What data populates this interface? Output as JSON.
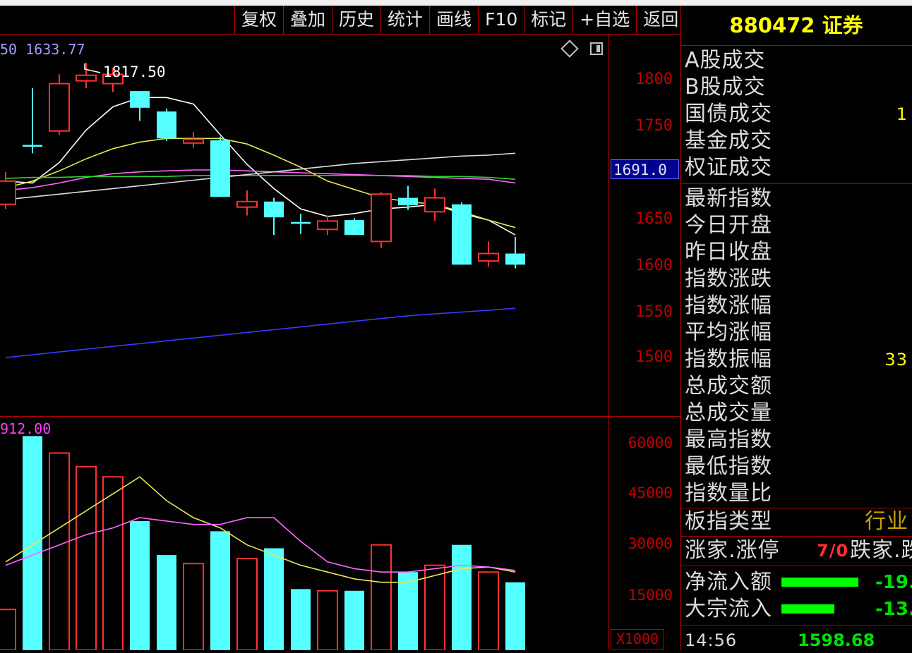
{
  "toolbar": {
    "buttons": [
      "复权",
      "叠加",
      "历史",
      "统计",
      "画线",
      "F10",
      "标记",
      "+自选",
      "返回"
    ]
  },
  "legend": {
    "top_text": "50  1633.77",
    "vol_text": "912.00"
  },
  "chart": {
    "high_label": "1817.50",
    "current_price_tag": "1691.0",
    "vol_unit": "X1000",
    "price_ticks": [
      "1800",
      "1750",
      "1650",
      "1600",
      "1550",
      "1500"
    ],
    "vol_ticks": [
      "60000",
      "45000",
      "30000",
      "15000"
    ]
  },
  "chart_data": {
    "type": "candlestick",
    "price_axis": {
      "ticks": [
        1800,
        1750,
        1650,
        1600,
        1550,
        1500
      ],
      "range": [
        1445,
        1880
      ]
    },
    "volume_axis": {
      "ticks": [
        60000,
        45000,
        30000,
        15000
      ],
      "unit": "X1000",
      "range": [
        0,
        62000
      ]
    },
    "candles": [
      {
        "o": 1665,
        "c": 1690,
        "h": 1700,
        "l": 1660,
        "color": "red"
      },
      {
        "o": 1727,
        "c": 1729,
        "h": 1790,
        "l": 1720,
        "color": "cyan"
      },
      {
        "o": 1744,
        "c": 1795,
        "h": 1805,
        "l": 1740,
        "color": "red"
      },
      {
        "o": 1798,
        "c": 1804,
        "h": 1817.5,
        "l": 1790,
        "color": "red"
      },
      {
        "o": 1795,
        "c": 1805,
        "h": 1812,
        "l": 1786,
        "color": "red"
      },
      {
        "o": 1787,
        "c": 1769,
        "h": 1787,
        "l": 1755,
        "color": "cyan"
      },
      {
        "o": 1765,
        "c": 1736,
        "h": 1768,
        "l": 1733,
        "color": "cyan"
      },
      {
        "o": 1731,
        "c": 1735,
        "h": 1743,
        "l": 1726,
        "color": "red"
      },
      {
        "o": 1734,
        "c": 1673,
        "h": 1738,
        "l": 1673,
        "color": "cyan"
      },
      {
        "o": 1662,
        "c": 1668,
        "h": 1680,
        "l": 1653,
        "color": "red"
      },
      {
        "o": 1668,
        "c": 1651,
        "h": 1672,
        "l": 1632,
        "color": "cyan"
      },
      {
        "o": 1646,
        "c": 1644,
        "h": 1655,
        "l": 1633,
        "color": "cyan"
      },
      {
        "o": 1638,
        "c": 1647,
        "h": 1653,
        "l": 1632,
        "color": "red"
      },
      {
        "o": 1648,
        "c": 1632,
        "h": 1650,
        "l": 1632,
        "color": "cyan"
      },
      {
        "o": 1625,
        "c": 1676,
        "h": 1678,
        "l": 1618,
        "color": "red"
      },
      {
        "o": 1672,
        "c": 1664,
        "h": 1685,
        "l": 1659,
        "color": "cyan"
      },
      {
        "o": 1657,
        "c": 1672,
        "h": 1682,
        "l": 1647,
        "color": "red"
      },
      {
        "o": 1665,
        "c": 1600,
        "h": 1667,
        "l": 1600,
        "color": "cyan"
      },
      {
        "o": 1604,
        "c": 1612,
        "h": 1625,
        "l": 1598,
        "color": "red"
      },
      {
        "o": 1612,
        "c": 1600,
        "h": 1630,
        "l": 1596,
        "color": "cyan"
      }
    ],
    "volumes": [
      {
        "v": 11000,
        "color": "red"
      },
      {
        "v": 62000,
        "color": "cyan"
      },
      {
        "v": 57000,
        "color": "red"
      },
      {
        "v": 53000,
        "color": "red"
      },
      {
        "v": 50000,
        "color": "red"
      },
      {
        "v": 37000,
        "color": "cyan"
      },
      {
        "v": 27000,
        "color": "cyan"
      },
      {
        "v": 24500,
        "color": "red"
      },
      {
        "v": 34000,
        "color": "cyan"
      },
      {
        "v": 26000,
        "color": "red"
      },
      {
        "v": 29000,
        "color": "cyan"
      },
      {
        "v": 17000,
        "color": "cyan"
      },
      {
        "v": 16500,
        "color": "red"
      },
      {
        "v": 16500,
        "color": "cyan"
      },
      {
        "v": 30000,
        "color": "red"
      },
      {
        "v": 22000,
        "color": "cyan"
      },
      {
        "v": 24000,
        "color": "red"
      },
      {
        "v": 30000,
        "color": "cyan"
      },
      {
        "v": 22000,
        "color": "red"
      },
      {
        "v": 19000,
        "color": "cyan"
      }
    ],
    "price_ma_lines": [
      {
        "color": "#ffffff",
        "values": [
          1690,
          1688,
          1710,
          1745,
          1770,
          1780,
          1780,
          1773,
          1740,
          1708,
          1682,
          1660,
          1652,
          1655,
          1660,
          1662,
          1665,
          1655,
          1648,
          1632
        ]
      },
      {
        "color": "#e8e850",
        "values": [
          1683,
          1690,
          1701,
          1714,
          1725,
          1732,
          1736,
          1736,
          1736,
          1730,
          1718,
          1705,
          1690,
          1681,
          1672,
          1668,
          1665,
          1657,
          1648,
          1640
        ]
      },
      {
        "color": "#ff66ff",
        "values": [
          1680,
          1683,
          1688,
          1694,
          1698,
          1700,
          1701,
          1702,
          1702,
          1701,
          1700,
          1699,
          1698,
          1697,
          1696,
          1695,
          1694,
          1693,
          1692,
          1688
        ]
      },
      {
        "color": "#30d030",
        "values": [
          1693,
          1694,
          1694,
          1695,
          1695,
          1695,
          1695,
          1696,
          1696,
          1696,
          1696,
          1696,
          1696,
          1696,
          1696,
          1696,
          1695,
          1695,
          1694,
          1692
        ]
      },
      {
        "color": "#dcdcdc",
        "values": [
          1670,
          1673,
          1676,
          1679,
          1682,
          1685,
          1688,
          1691,
          1694,
          1697,
          1700,
          1703,
          1706,
          1709,
          1711,
          1713,
          1715,
          1717,
          1718,
          1720
        ]
      },
      {
        "color": "#3a3aff",
        "values": [
          1500,
          1503,
          1506,
          1509,
          1512,
          1515,
          1518,
          1521,
          1524,
          1527,
          1530,
          1533,
          1536,
          1539,
          1542,
          1545,
          1547,
          1549,
          1551,
          1553
        ]
      }
    ],
    "volume_ma_lines": [
      {
        "color": "#e8e850",
        "values": [
          25000,
          30000,
          35000,
          40000,
          45000,
          50000,
          43000,
          38000,
          35000,
          30000,
          27000,
          24000,
          22000,
          20000,
          19000,
          19000,
          21000,
          23000,
          23500,
          22000
        ]
      },
      {
        "color": "#ff66ff",
        "values": [
          24000,
          27000,
          30000,
          33000,
          35000,
          38000,
          37000,
          36000,
          36000,
          38000,
          38000,
          31000,
          25000,
          23000,
          22000,
          22000,
          23000,
          24000,
          23500,
          22500
        ]
      }
    ]
  },
  "panel": {
    "title": "880472 证券",
    "stats": [
      {
        "label": "A股成交",
        "value": ""
      },
      {
        "label": "B股成交",
        "value": ""
      },
      {
        "label": "国债成交",
        "value": "1"
      },
      {
        "label": "基金成交",
        "value": ""
      },
      {
        "label": "权证成交",
        "value": ""
      },
      {
        "label": "最新指数",
        "value": ""
      },
      {
        "label": "今日开盘",
        "value": ""
      },
      {
        "label": "昨日收盘",
        "value": ""
      },
      {
        "label": "指数涨跌",
        "value": ""
      },
      {
        "label": "指数涨幅",
        "value": ""
      },
      {
        "label": "平均涨幅",
        "value": ""
      },
      {
        "label": "指数振幅",
        "value": "33"
      },
      {
        "label": "总成交额",
        "value": ""
      },
      {
        "label": "总成交量",
        "value": ""
      },
      {
        "label": "最高指数",
        "value": ""
      },
      {
        "label": "最低指数",
        "value": ""
      },
      {
        "label": "指数量比",
        "value": ""
      }
    ],
    "type_label": "板指类型",
    "type_value": "行业",
    "rise_label": "涨家.涨停",
    "rise_value": "7/0",
    "fall_label": "跌家.跌",
    "net_inflow_label": "净流入额",
    "net_inflow_value": "-19.",
    "bulk_inflow_label": "大宗流入",
    "bulk_inflow_value": "-13.",
    "time": "14:56",
    "last_price": "1598.68"
  }
}
